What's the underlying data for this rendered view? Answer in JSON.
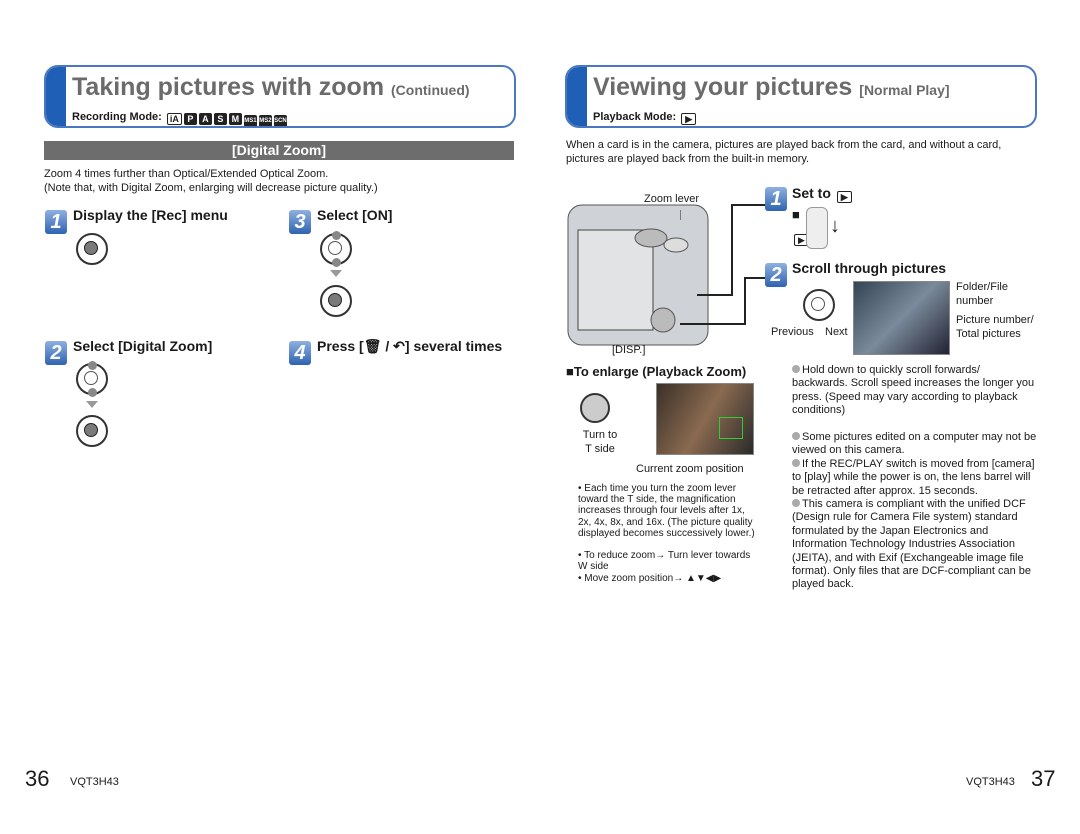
{
  "left": {
    "title": "Taking pictures with zoom",
    "title_suffix": "(Continued)",
    "mode_label": "Recording Mode:",
    "modes": [
      "iA",
      "P",
      "A",
      "S",
      "M",
      "MS1",
      "MS2",
      "SCN"
    ],
    "section": "[Digital Zoom]",
    "intro": [
      "Zoom 4 times further than Optical/Extended Optical Zoom.",
      "(Note that, with Digital Zoom, enlarging will decrease picture quality.)"
    ],
    "steps": [
      {
        "n": "1",
        "text": "Display the [Rec] menu"
      },
      {
        "n": "2",
        "text": "Select [Digital Zoom]"
      },
      {
        "n": "3",
        "text": "Select [ON]"
      },
      {
        "n": "4",
        "text_pre": "Press [",
        "text_post": "] several times"
      }
    ]
  },
  "right": {
    "title": "Viewing your pictures",
    "title_suffix": "[Normal Play]",
    "mode_label": "Playback Mode:",
    "intro": "When a card is in the camera, pictures are played back from the card, and without a card, pictures are played back from the built-in memory.",
    "zoom_lever": "Zoom lever",
    "disp": "[DISP.]",
    "step1": {
      "n": "1",
      "text": "Set to"
    },
    "step2": {
      "n": "2",
      "text": "Scroll through pictures"
    },
    "previous": "Previous",
    "next": "Next",
    "folder_file": "Folder/File number",
    "picture_number": "Picture number/ Total pictures",
    "enlarge_title": "■To enlarge (Playback Zoom)",
    "turn_to": "Turn to T side",
    "current_zoom": "Current zoom position",
    "enlarge_bullets": [
      "Each time you turn the zoom lever toward the T side, the magnification increases through four levels after 1x, 2x, 4x, 8x, and 16x. (The picture quality displayed becomes successively lower.)",
      "To reduce zoom→ Turn lever towards W side",
      "Move zoom position→ ▲▼◀▶"
    ],
    "notes": [
      "Hold down to quickly scroll forwards/ backwards. Scroll speed increases the longer you press. (Speed may vary according to playback conditions)",
      "Some pictures edited on a computer may not be viewed on this camera.",
      "If the REC/PLAY switch is moved from [camera] to [play] while the power is on, the lens barrel will be retracted after approx. 15 seconds.",
      "This camera is compliant with the unified DCF (Design rule for Camera File system) standard formulated by the Japan Electronics and Information Technology Industries Association (JEITA), and with Exif (Exchangeable image file format). Only files that are DCF-compliant can be played back."
    ]
  },
  "footer": {
    "left_page": "36",
    "right_page": "37",
    "code": "VQT3H43"
  },
  "colors": {
    "accent": "#1f5fb5",
    "border": "#4a78c0",
    "section_bar": "#6d6d6d"
  }
}
